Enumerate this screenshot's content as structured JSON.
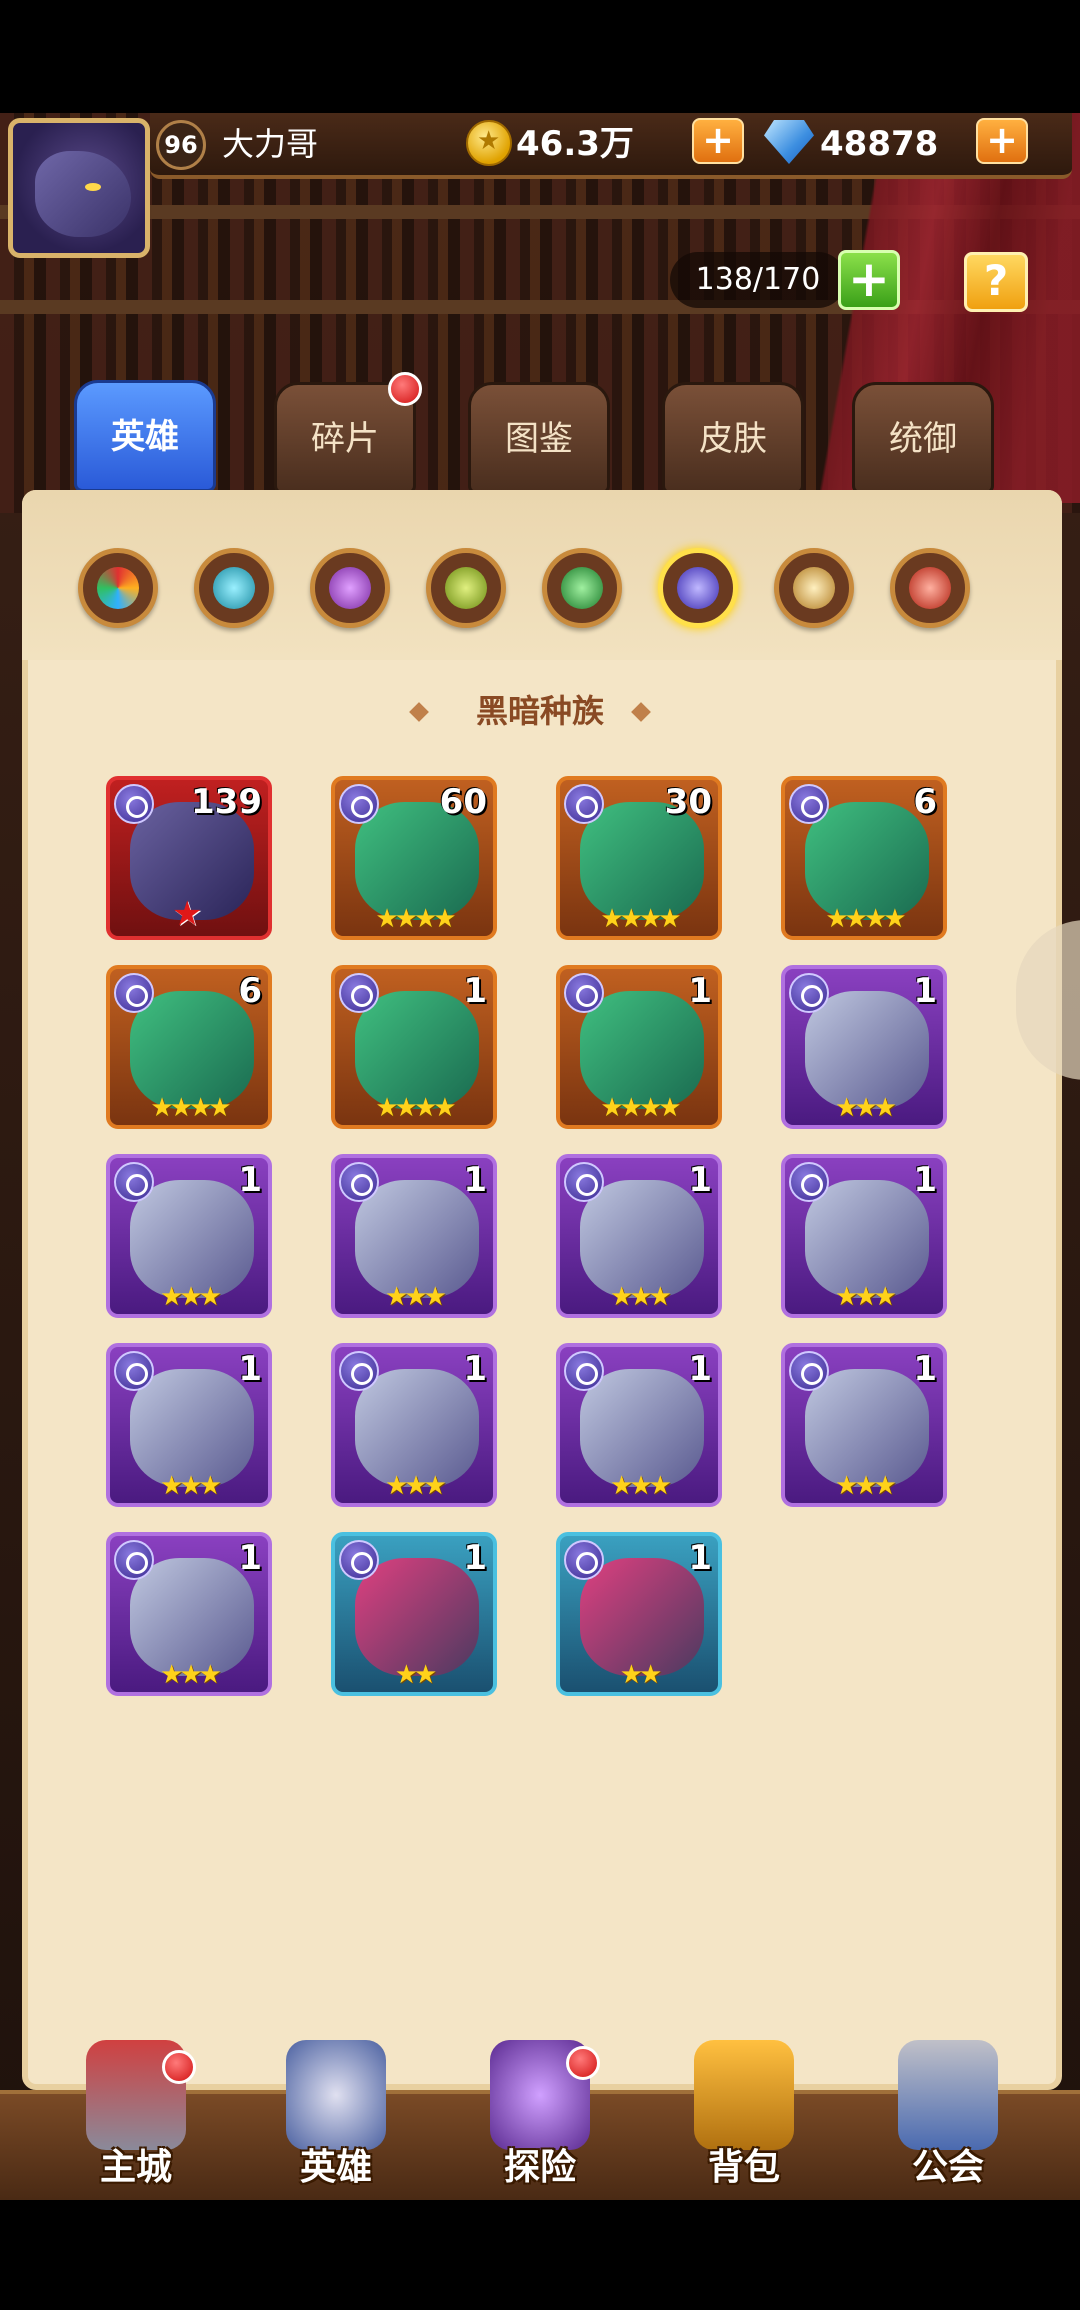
{
  "player": {
    "level": "96",
    "name": "大力哥",
    "gold": "46.3万",
    "gems": "48878"
  },
  "capacity": "138/170",
  "icons": {
    "plus": "+",
    "help": "?"
  },
  "tabs": [
    {
      "label": "英雄",
      "active": true
    },
    {
      "label": "碎片",
      "active": false,
      "has_dot": true
    },
    {
      "label": "图鉴",
      "active": false
    },
    {
      "label": "皮肤",
      "active": false
    },
    {
      "label": "统御",
      "active": false
    }
  ],
  "race_filters": [
    "all-races",
    "race-2",
    "race-3",
    "race-4",
    "race-5",
    "dark",
    "race-7",
    "race-8"
  ],
  "selected_race_title": "黑暗种族",
  "heroes": [
    {
      "count": "139",
      "stars": "",
      "red_star": "★",
      "frame": "red"
    },
    {
      "count": "60",
      "stars": "★★★★",
      "frame": "orange"
    },
    {
      "count": "30",
      "stars": "★★★★",
      "frame": "orange"
    },
    {
      "count": "6",
      "stars": "★★★★",
      "frame": "orange"
    },
    {
      "count": "6",
      "stars": "★★★★",
      "frame": "orange"
    },
    {
      "count": "1",
      "stars": "★★★★",
      "frame": "orange"
    },
    {
      "count": "1",
      "stars": "★★★★",
      "frame": "orange"
    },
    {
      "count": "1",
      "stars": "★★★",
      "frame": "purple"
    },
    {
      "count": "1",
      "stars": "★★★",
      "frame": "purple"
    },
    {
      "count": "1",
      "stars": "★★★",
      "frame": "purple"
    },
    {
      "count": "1",
      "stars": "★★★",
      "frame": "purple"
    },
    {
      "count": "1",
      "stars": "★★★",
      "frame": "purple"
    },
    {
      "count": "1",
      "stars": "★★★",
      "frame": "purple"
    },
    {
      "count": "1",
      "stars": "★★★",
      "frame": "purple"
    },
    {
      "count": "1",
      "stars": "★★★",
      "frame": "purple"
    },
    {
      "count": "1",
      "stars": "★★★",
      "frame": "purple"
    },
    {
      "count": "1",
      "stars": "★★★",
      "frame": "purple"
    },
    {
      "count": "1",
      "stars": "★★",
      "frame": "blue"
    },
    {
      "count": "1",
      "stars": "★★",
      "frame": "blue"
    }
  ],
  "nav": [
    {
      "label": "主城",
      "has_dot": true
    },
    {
      "label": "英雄",
      "has_dot": false
    },
    {
      "label": "探险",
      "has_dot": true
    },
    {
      "label": "背包",
      "has_dot": false
    },
    {
      "label": "公会",
      "has_dot": false
    }
  ]
}
